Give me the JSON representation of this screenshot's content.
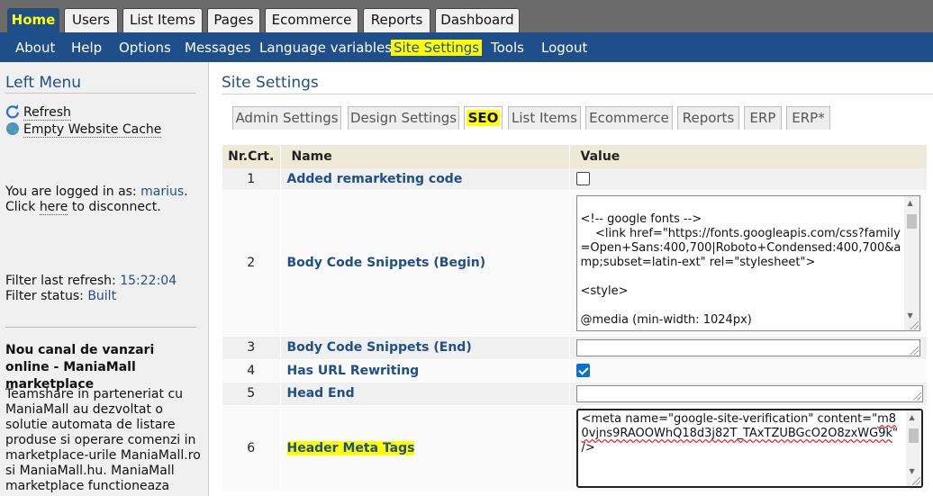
{
  "top_tabs": [
    "Home",
    "Users",
    "List Items",
    "Pages",
    "Ecommerce",
    "Reports",
    "Dashboard"
  ],
  "sub_nav": [
    "About",
    "Help",
    "Options",
    "Messages",
    "Language variables",
    "Site Settings",
    "Tools",
    "Logout"
  ],
  "left_menu": {
    "title": "Left Menu",
    "refresh": "Refresh",
    "empty_cache": "Empty Website Cache",
    "logged_in_prefix": "You are logged in as:",
    "username": "marius",
    "username_suffix": ".",
    "click": "Click",
    "here": "here",
    "disconnect": "to disconnect.",
    "filter_refresh_label": "Filter last refresh:",
    "filter_refresh_value": "15:22:04",
    "filter_status_label": "Filter status:",
    "filter_status_value": "Built",
    "news_title": "Nou canal de vanzari online - ManiaMall marketplace",
    "news_body": "Teamshare in parteneriat cu ManiaMall au dezvoltat o solutie automata de listare produse si operare comenzi in marketplace-urile ManiaMall.ro si ManiaMall.hu. ManiaMall marketplace functioneaza"
  },
  "main": {
    "title": "Site Settings",
    "tabs": [
      "Admin Settings",
      "Design Settings",
      "SEO",
      "List Items",
      "Ecommerce",
      "Reports",
      "ERP",
      "ERP*"
    ],
    "active_tab": "SEO",
    "columns": [
      "Nr.Crt.",
      "Name",
      "Value"
    ],
    "rows": [
      {
        "nr": "1",
        "name": "Added remarketing code"
      },
      {
        "nr": "2",
        "name": "Body Code Snippets (Begin)",
        "value": "\n<!-- google fonts -->\n    <link href=\"https://fonts.googleapis.com/css?family=Open+Sans:400,700|Roboto+Condensed:400,700&amp;subset=latin-ext\" rel=\"stylesheet\">\n\n<style>\n\n@media (min-width: 1024px)\n"
      },
      {
        "nr": "3",
        "name": "Body Code Snippets (End)",
        "value": ""
      },
      {
        "nr": "4",
        "name": "Has URL Rewriting"
      },
      {
        "nr": "5",
        "name": "Head End",
        "value": ""
      },
      {
        "nr": "6",
        "name": "Header Meta Tags",
        "value_prefix": "<meta name=\"google-site-verification\" content=\"",
        "value_code": "m80vjns9RAOOWhQ18d3j82T_TAxTZUBGcO2O8zxWG9k",
        "value_suffix": "\" />"
      }
    ]
  },
  "colors": {
    "nav_blue": "#1f4f8b",
    "highlight": "#ffff00",
    "tab_bar_gray": "#6b6b6b",
    "checkbox_blue": "#0b6fd0"
  },
  "checkboxes": {
    "row1": false,
    "row4": true
  }
}
